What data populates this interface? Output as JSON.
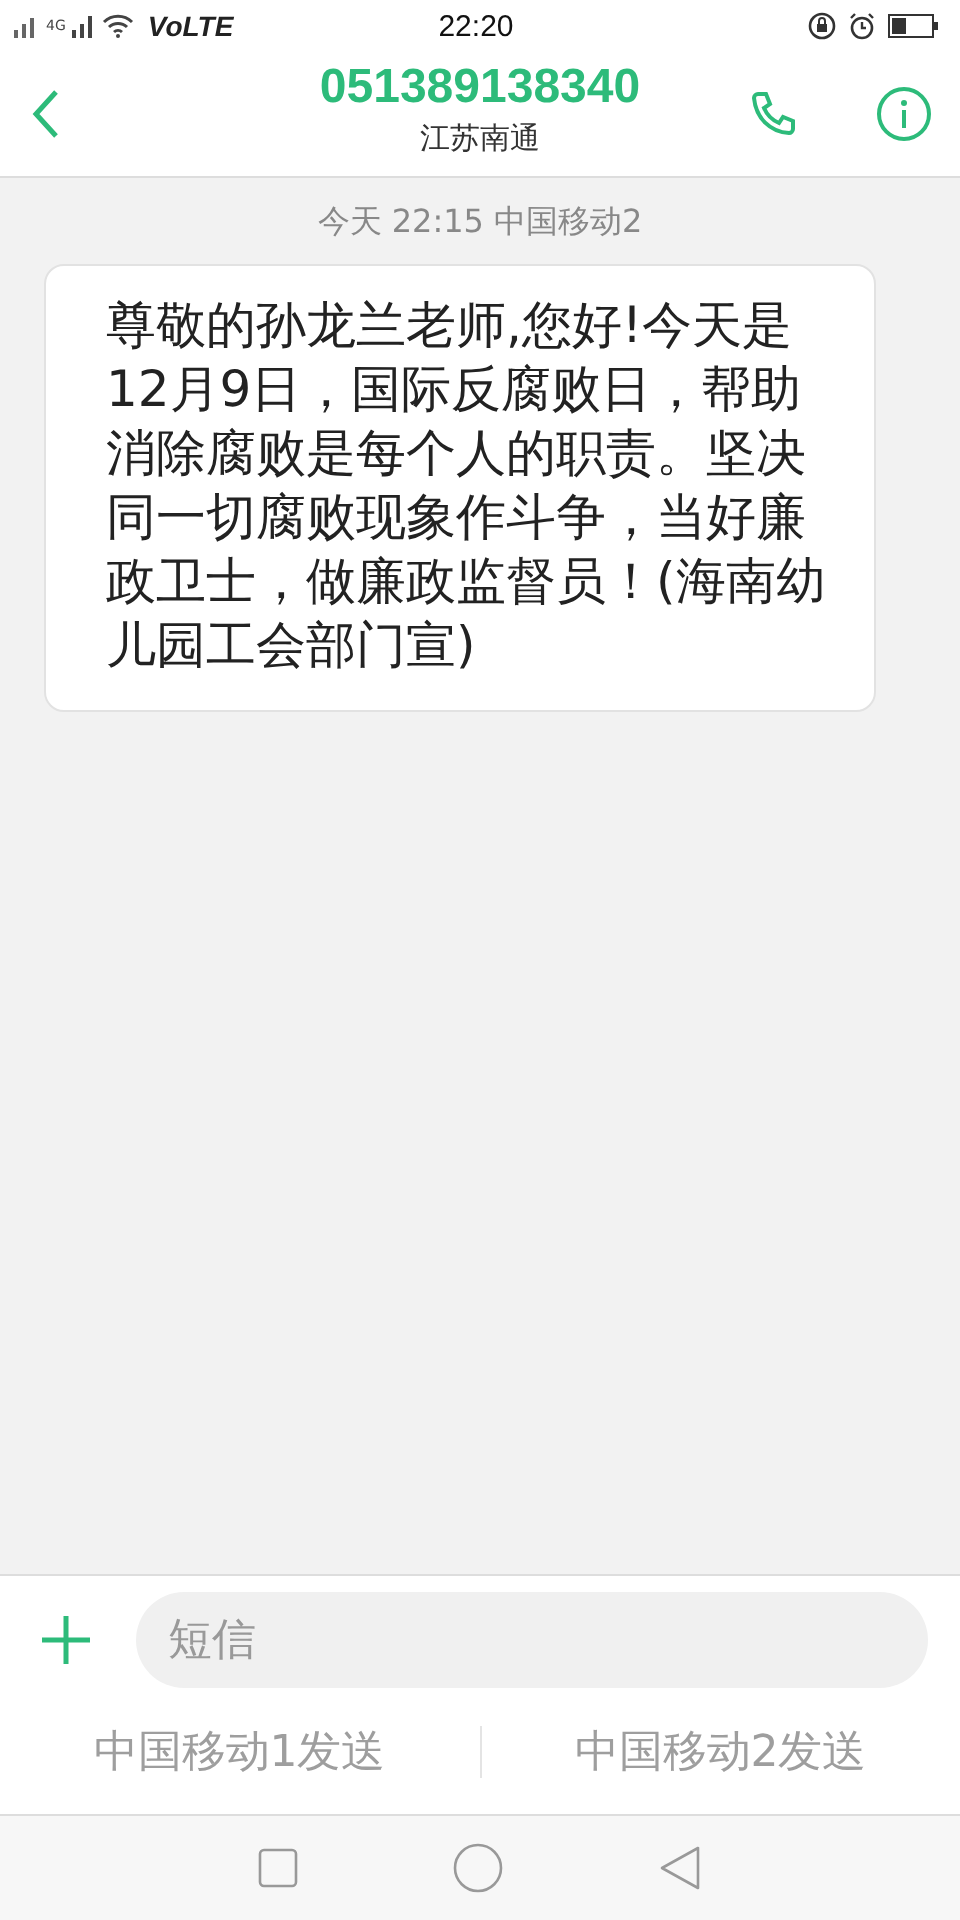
{
  "status_bar": {
    "carrier": "VoLTE",
    "time": "22:20",
    "network": "4G"
  },
  "header": {
    "title": "051389138340",
    "subtitle": "江苏南通"
  },
  "messages": [
    {
      "timestamp": "今天 22:15  中国移动2",
      "text": "尊敬的孙龙兰老师,您好!今天是12月9日，国际反腐败日，帮助消除腐败是每个人的职责。坚决同一切腐败现象作斗争，当好廉政卫士，做廉政监督员！(海南幼儿园工会部门宣)"
    }
  ],
  "composer": {
    "placeholder": "短信"
  },
  "send_buttons": [
    {
      "label": "中国移动1发送",
      "disabled": true
    },
    {
      "label": "中国移动2发送",
      "disabled": true
    }
  ]
}
